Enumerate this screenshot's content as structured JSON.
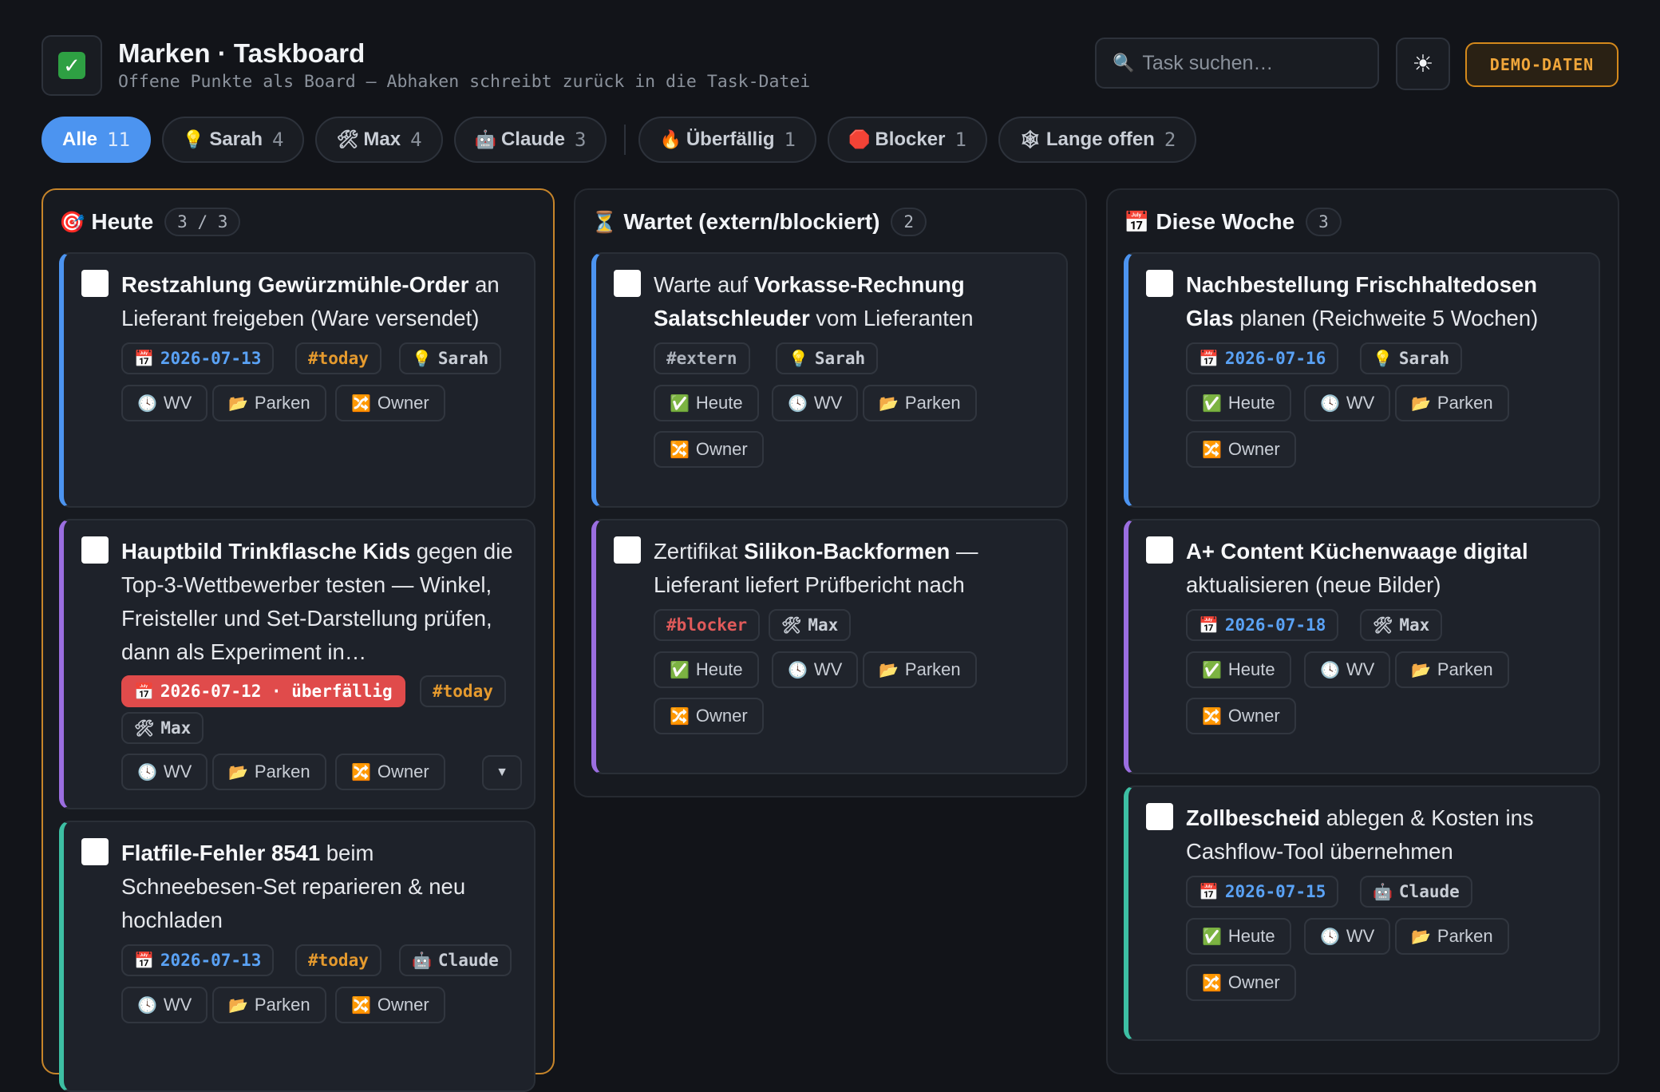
{
  "header": {
    "title": "Marken · Taskboard",
    "subtitle": "Offene Punkte als Board — Abhaken schreibt zurück in die Task-Datei",
    "logo_icon": "check-box-icon",
    "search_placeholder": "Task suchen…",
    "theme_icon": "☀",
    "demo_label": "DEMO-DATEN"
  },
  "filters": [
    {
      "label": "Alle",
      "count": "11",
      "icon": ""
    },
    {
      "label": "Sarah",
      "count": "4",
      "icon": "💡"
    },
    {
      "label": "Max",
      "count": "4",
      "icon": "🛠"
    },
    {
      "label": "Claude",
      "count": "3",
      "icon": "🤖"
    },
    {
      "label": "Überfällig",
      "count": "1",
      "icon": "🔥"
    },
    {
      "label": "Blocker",
      "count": "1",
      "icon": "🛑"
    },
    {
      "label": "Lange offen",
      "count": "2",
      "icon": "🕸"
    }
  ],
  "actions": {
    "heute": "Heute",
    "wv": "WV",
    "parken": "Parken",
    "owner": "Owner"
  },
  "columns": [
    {
      "name": "Heute",
      "icon": "🎯",
      "count": "3 / 3",
      "cards": [
        {
          "bold": "Restzahlung Gewürzmühle-Order",
          "text": " an Lieferant freigeben (Ware versendet)",
          "date": "2026-07-13",
          "tag": "#today",
          "owner": "Sarah",
          "owner_icon": "💡"
        },
        {
          "bold": "Hauptbild Trinkflasche Kids",
          "text": " gegen die Top-3-Wettbewerber testen — Winkel, Freisteller und Set-Darstellung prüfen, dann als Experiment in…",
          "date": "2026-07-12 · überfällig",
          "tag": "#today",
          "owner": "Max",
          "owner_icon": "🛠",
          "expand": "▼"
        },
        {
          "bold": "Flatfile-Fehler 8541",
          "text": " beim Schneebesen-Set reparieren & neu hochladen",
          "date": "2026-07-13",
          "tag": "#today",
          "owner": "Claude",
          "owner_icon": "🤖"
        }
      ]
    },
    {
      "name": "Wartet (extern/blockiert)",
      "icon": "⏳",
      "count": "2",
      "cards": [
        {
          "pre": "Warte auf ",
          "bold": "Vorkasse-Rechnung Salatschleuder",
          "text": " vom Lieferanten",
          "tag": "#extern",
          "owner": "Sarah",
          "owner_icon": "💡"
        },
        {
          "pre": "Zertifikat ",
          "bold": "Silikon-Backformen",
          "text": " — Lieferant liefert Prüfbericht nach",
          "tag": "#blocker",
          "owner": "Max",
          "owner_icon": "🛠"
        }
      ]
    },
    {
      "name": "Diese Woche",
      "icon": "📅",
      "count": "3",
      "cards": [
        {
          "bold": "Nachbestellung Frischhaltedosen Glas",
          "text": " planen (Reichweite 5 Wochen)",
          "date": "2026-07-16",
          "owner": "Sarah",
          "owner_icon": "💡"
        },
        {
          "bold": "A+ Content Küchenwaage digital",
          "text": " aktualisieren (neue Bilder)",
          "date": "2026-07-18",
          "owner": "Max",
          "owner_icon": "🛠"
        },
        {
          "bold": "Zollbescheid",
          "text": " ablegen & Kosten ins Cashflow-Tool übernehmen",
          "date": "2026-07-15",
          "owner": "Claude",
          "owner_icon": "🤖"
        }
      ]
    }
  ]
}
